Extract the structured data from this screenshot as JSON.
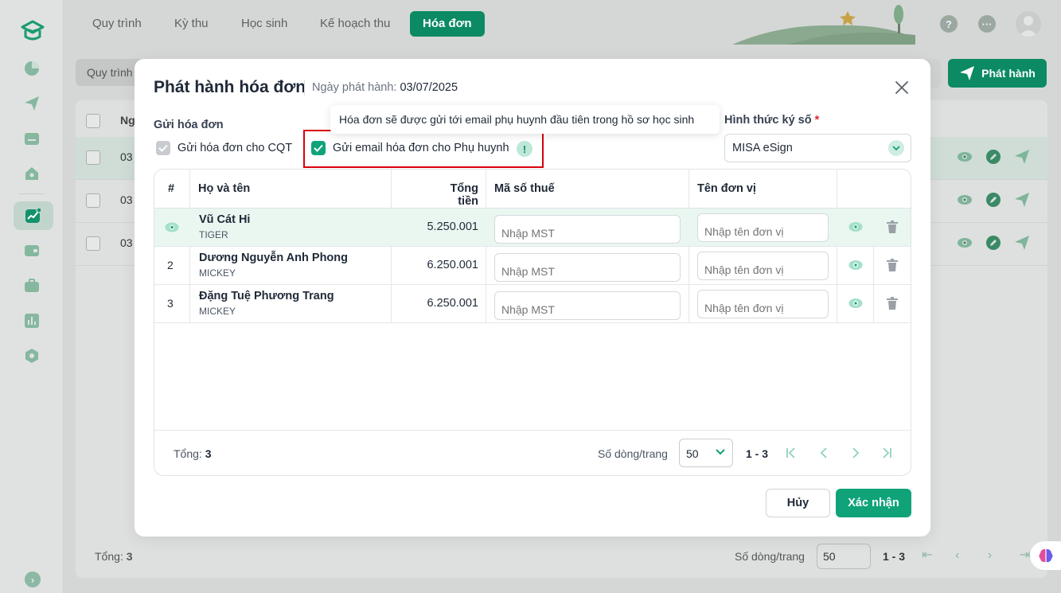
{
  "app": {
    "tabs": [
      {
        "label": "Quy trình"
      },
      {
        "label": "Kỳ thu"
      },
      {
        "label": "Học sinh"
      },
      {
        "label": "Kế hoạch thu"
      },
      {
        "label": "Hóa đơn",
        "active": true
      }
    ],
    "top_icons": [
      "help-icon",
      "more-icon",
      "user-avatar"
    ],
    "toolbar": {
      "left_label": "Quy trình",
      "issue_button": "Phát hành"
    },
    "background_table": {
      "header_partial": "Ng",
      "rows": [
        {
          "cell_partial": "03",
          "selected": true
        },
        {
          "cell_partial": "03",
          "selected": false
        },
        {
          "cell_partial": "03",
          "selected": false
        }
      ],
      "footer": {
        "total_label": "Tổng:",
        "total_value": "3",
        "rows_label": "Số dòng/trang",
        "rows_value": "50",
        "range": "1 - 3"
      }
    }
  },
  "modal": {
    "title": "Phát hành hóa đơn",
    "date_label": "Ngày phát hành:",
    "date_value": "03/07/2025",
    "send_section_title": "Gửi hóa đơn",
    "send_cqt_label": "Gửi hóa đơn cho CQT",
    "send_cqt_checked": true,
    "send_email_label": "Gửi email hóa đơn cho Phụ huynh",
    "send_email_checked": true,
    "tooltip": "Hóa đơn sẽ được gửi tới email phụ huynh đầu tiên trong hồ sơ học sinh",
    "sign_label": "Hình thức ký số",
    "sign_required": "*",
    "sign_value": "MISA eSign",
    "table": {
      "columns": [
        "#",
        "Họ và tên",
        "Tổng tiền",
        "Mã số thuế",
        "Tên đơn vị"
      ],
      "rows": [
        {
          "num": "",
          "name": "Vũ Cát Hi",
          "class": "TIGER",
          "amount": "5.250.001",
          "tax_placeholder": "Nhập MST",
          "unit_placeholder": "Nhập tên đơn vị",
          "selected": true
        },
        {
          "num": "2",
          "name": "Dương Nguyễn Anh Phong",
          "class": "MICKEY",
          "amount": "6.250.001",
          "tax_placeholder": "Nhập MST",
          "unit_placeholder": "Nhập tên đơn vị",
          "selected": false
        },
        {
          "num": "3",
          "name": "Đặng Tuệ Phương Trang",
          "class": "MICKEY",
          "amount": "6.250.001",
          "tax_placeholder": "Nhập MST",
          "unit_placeholder": "Nhập tên đơn vị",
          "selected": false
        }
      ]
    },
    "footer": {
      "total_label": "Tổng:",
      "total_value": "3",
      "rows_label": "Số dòng/trang",
      "rows_value": "50",
      "range": "1 - 3"
    },
    "cancel_label": "Hủy",
    "confirm_label": "Xác nhận"
  },
  "colors": {
    "primary": "#10a37a",
    "highlight": "#d9000d"
  }
}
